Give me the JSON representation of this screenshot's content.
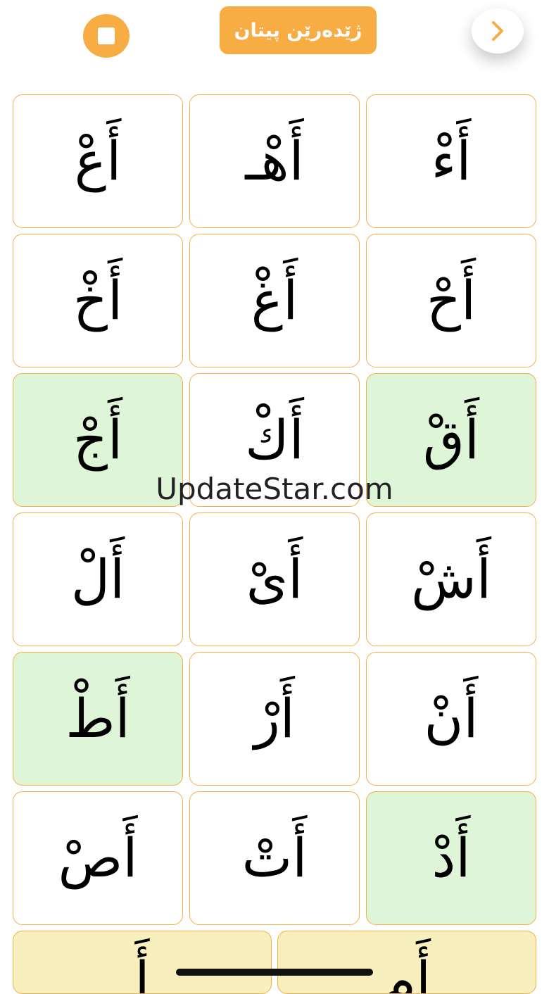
{
  "header": {
    "title": "ژێدەرێن پیتان",
    "stop_icon": "stop-icon",
    "next_icon": "chevron-right-icon",
    "accent": "#f7ad44"
  },
  "grid": {
    "row_0": [
      {
        "letter": "أَعْ",
        "highlighted": false
      },
      {
        "letter": "أَهْـ",
        "highlighted": false
      },
      {
        "letter": "أَءْ",
        "highlighted": false
      }
    ],
    "row_1": [
      {
        "letter": "أَخْ",
        "highlighted": false
      },
      {
        "letter": "أَغْ",
        "highlighted": false
      },
      {
        "letter": "أَحْ",
        "highlighted": false
      }
    ],
    "row_2": [
      {
        "letter": "أَجْ",
        "highlighted": true
      },
      {
        "letter": "أَكْ",
        "highlighted": false
      },
      {
        "letter": "أَقْ",
        "highlighted": true
      }
    ],
    "row_3": [
      {
        "letter": "أَلْ",
        "highlighted": false
      },
      {
        "letter": "أَىْ",
        "highlighted": false
      },
      {
        "letter": "أَشْ",
        "highlighted": false
      }
    ],
    "row_4": [
      {
        "letter": "أَطْ",
        "highlighted": true
      },
      {
        "letter": "أَرْ",
        "highlighted": false
      },
      {
        "letter": "أَنْ",
        "highlighted": false
      }
    ],
    "row_5": [
      {
        "letter": "أَصْ",
        "highlighted": false
      },
      {
        "letter": "أَتْ",
        "highlighted": false
      },
      {
        "letter": "أَدْ",
        "highlighted": true
      }
    ]
  },
  "bottom_row": [
    {
      "letter": "أَ",
      "highlighted": true
    },
    {
      "letter": "أَم",
      "highlighted": true
    }
  ],
  "watermark": "UpdateStar.com",
  "colors": {
    "card_border": "#f5b04a",
    "highlight_bg": "#dff5d8",
    "bottom_bg": "#f7efbd"
  }
}
